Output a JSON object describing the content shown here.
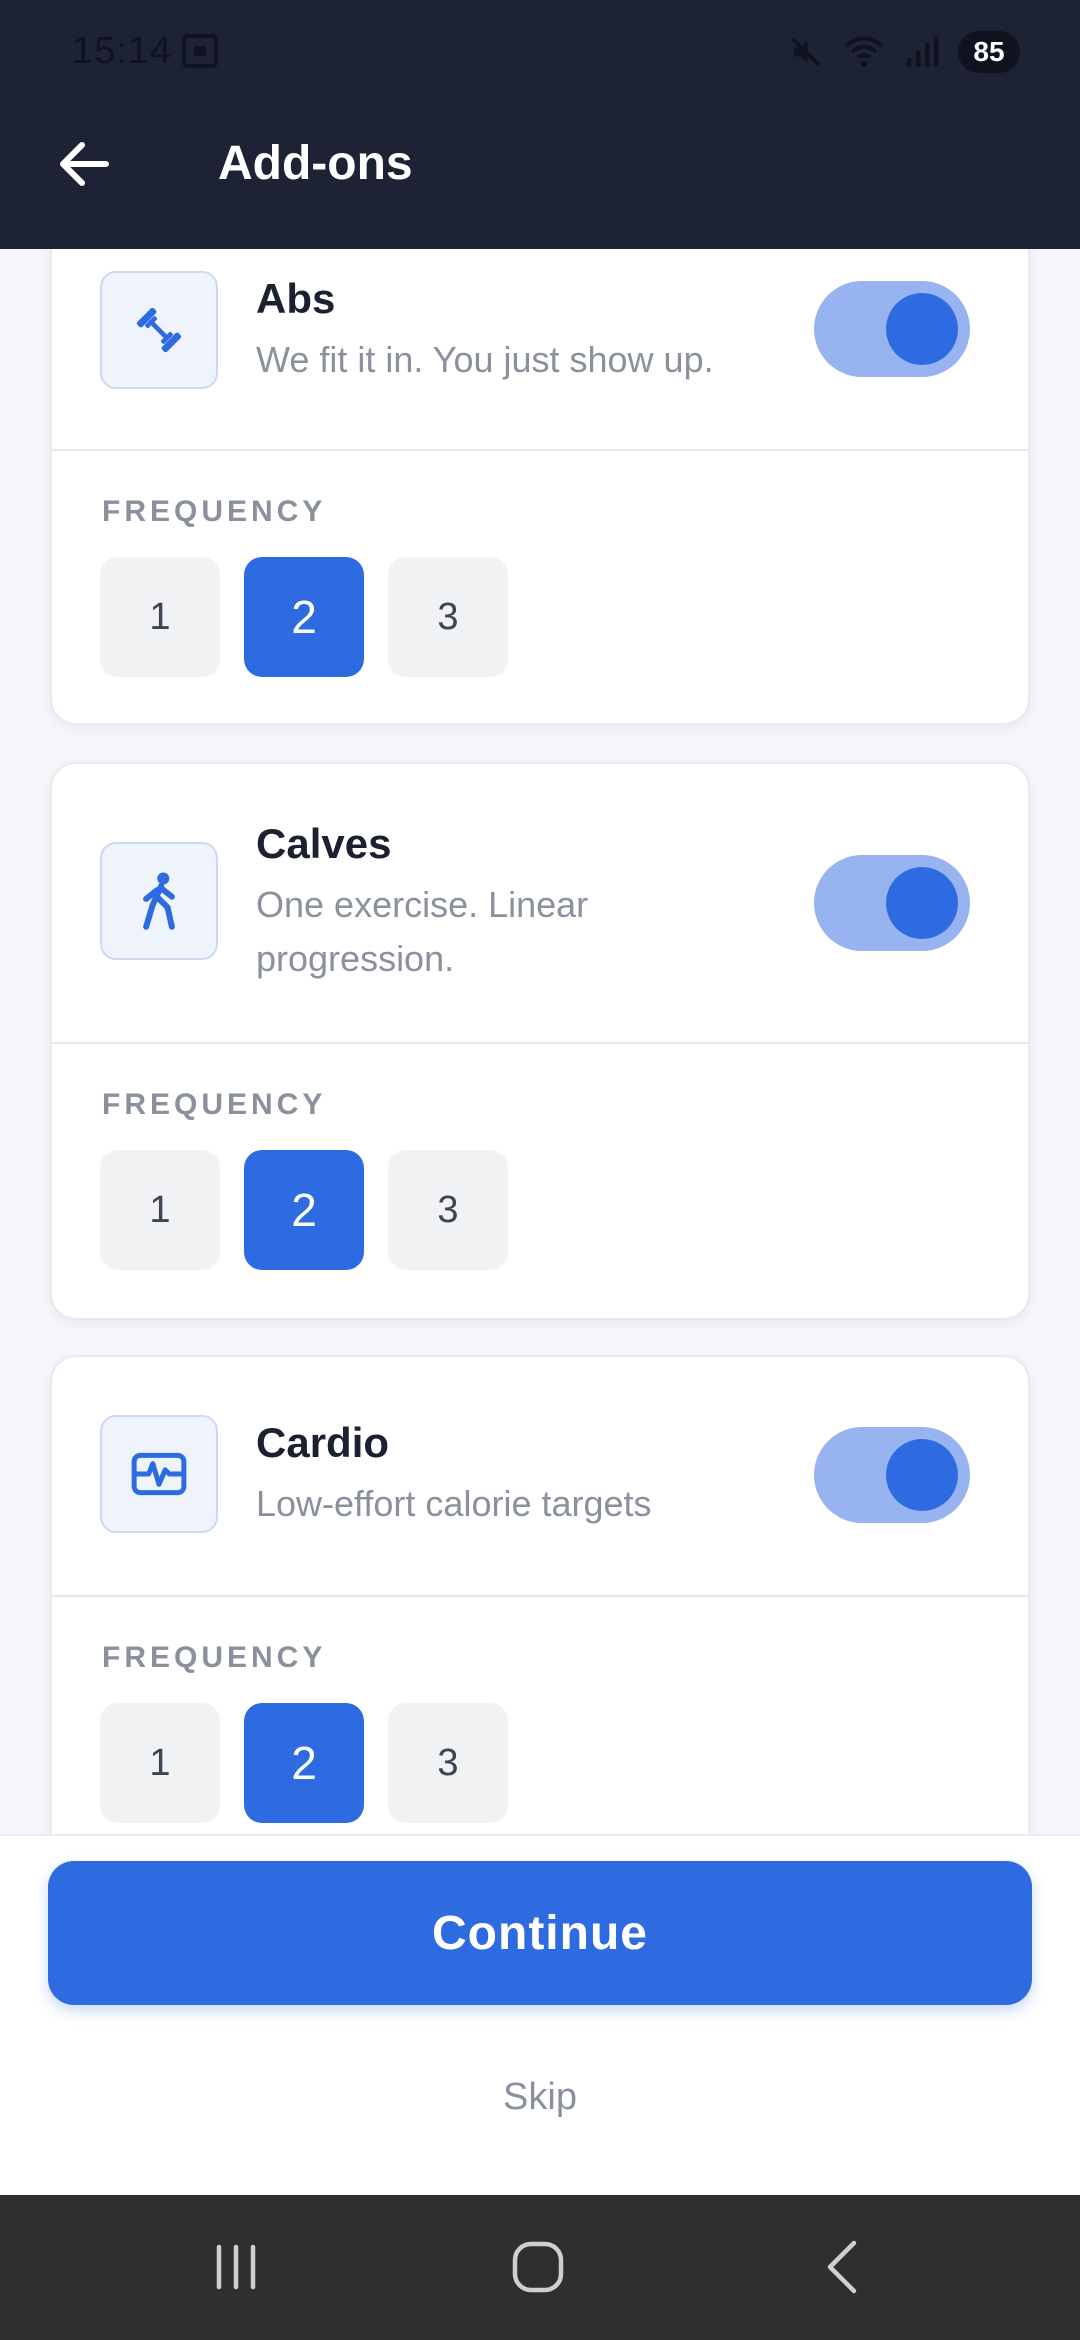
{
  "status_bar": {
    "time": "15:14",
    "battery": "85"
  },
  "header": {
    "title": "Add-ons"
  },
  "addons": [
    {
      "title": "Abs",
      "description": "We fit it in. You just show up.",
      "icon": "dumbbell-icon",
      "enabled": true,
      "frequency_label": "FREQUENCY",
      "frequency_options": [
        "1",
        "2",
        "3"
      ],
      "selected_frequency": "2"
    },
    {
      "title": "Calves",
      "description": "One exercise. Linear progression.",
      "icon": "walking-person-icon",
      "enabled": true,
      "frequency_label": "FREQUENCY",
      "frequency_options": [
        "1",
        "2",
        "3"
      ],
      "selected_frequency": "2"
    },
    {
      "title": "Cardio",
      "description": "Low-effort calorie targets",
      "icon": "heartbeat-monitor-icon",
      "enabled": true,
      "frequency_label": "FREQUENCY",
      "frequency_options": [
        "1",
        "2",
        "3"
      ],
      "selected_frequency": "2"
    }
  ],
  "actions": {
    "continue_label": "Continue",
    "skip_label": "Skip"
  },
  "colors": {
    "header_bg": "#1d2234",
    "accent": "#2f6be0",
    "toggle_track": "#97b3f0"
  }
}
